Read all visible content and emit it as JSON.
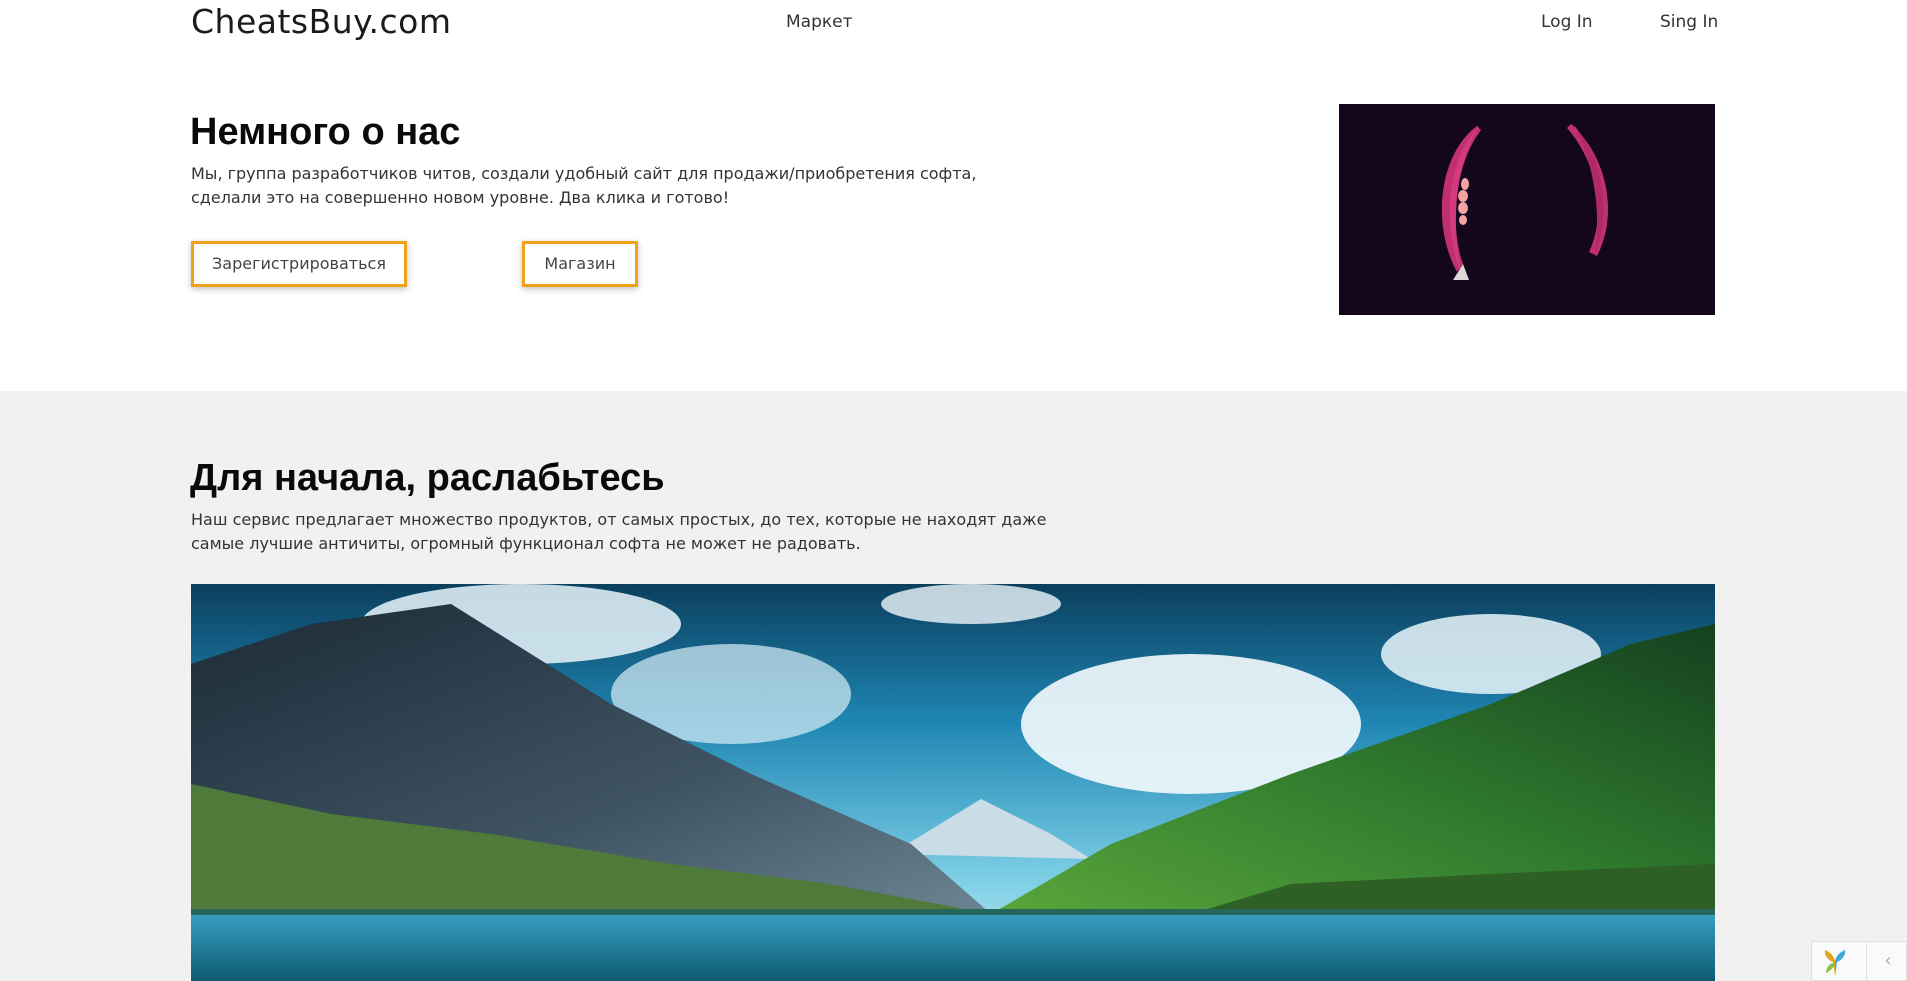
{
  "header": {
    "logo": "CheatsBuy.com",
    "nav": {
      "market": "Маркет",
      "login": "Log In",
      "signin": "Sing In"
    }
  },
  "about": {
    "title": "Немного о нас",
    "text": "Мы, группа разработчиков читов, создали удобный сайт для продажи/приобретения софта, сделали это на совершенно новом уровне. Два клика и готово!",
    "register_button": "Зарегистрироваться",
    "shop_button": "Магазин"
  },
  "intro": {
    "title": "Для начала, раслабьтесь",
    "text": "Наш сервис предлагает множество продуктов, от самых простых, до тех, которые не находят даже самые лучшие античиты, огромный функционал софта не может не радовать."
  },
  "widget": {
    "toggle": "‹"
  },
  "colors": {
    "button_border": "#f0a21c",
    "promo_bg": "#14061d",
    "promo_accent": "#c0306f",
    "section_gray": "#f1f1f1"
  },
  "icons": [
    "yii-logo-icon",
    "chevron-left-icon"
  ]
}
